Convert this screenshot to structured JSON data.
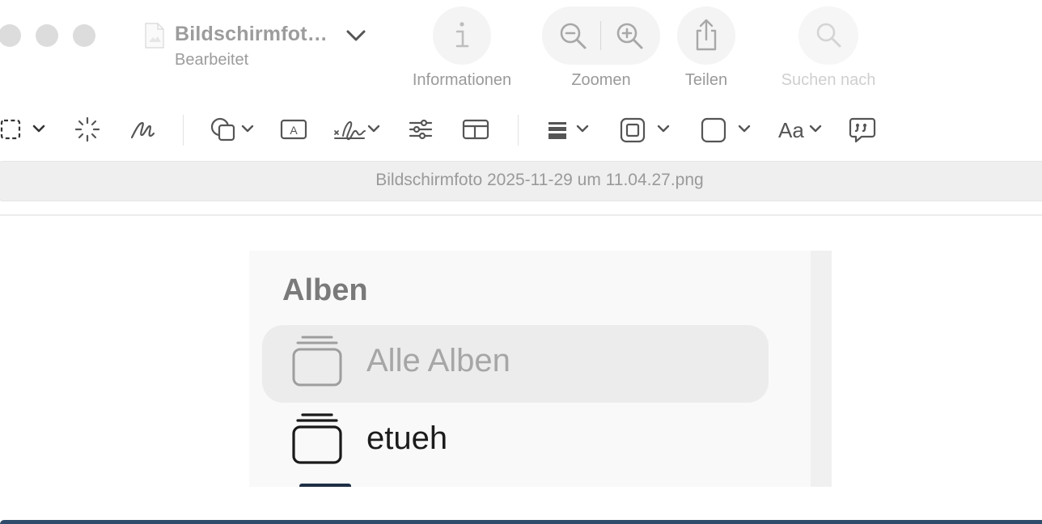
{
  "window": {
    "title": "Bildschirmfot…",
    "subtitle": "Bearbeitet"
  },
  "toolbar": {
    "info_label": "Informationen",
    "zoom_label": "Zoomen",
    "share_label": "Teilen",
    "search_label": "Suchen nach"
  },
  "markup": {
    "font_label": "Aa"
  },
  "file": {
    "name": "Bildschirmfoto 2025-11-29 um 11.04.27.png"
  },
  "screenshot": {
    "section_title": "Alben",
    "items": [
      {
        "label": "Alle Alben",
        "selected": true,
        "icon": "albums-stack-icon"
      },
      {
        "label": "etueh",
        "selected": false,
        "icon": "albums-stack-icon"
      }
    ]
  },
  "colors": {
    "window_bg": "#ffffff",
    "muted_text": "#9a9a9a",
    "bottom_accent": "#2f4d6b"
  }
}
